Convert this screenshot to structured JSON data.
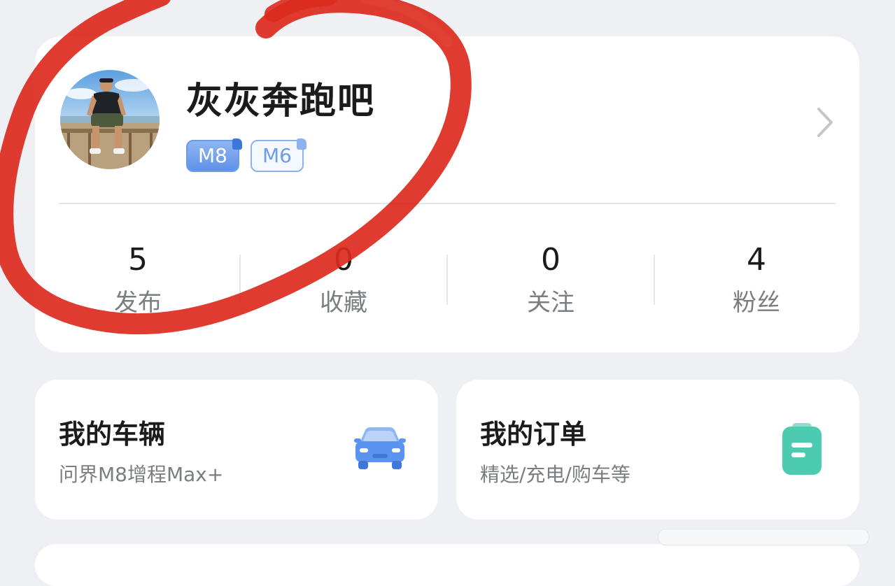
{
  "profile": {
    "username": "灰灰奔跑吧",
    "badges": [
      "M8",
      "M6"
    ],
    "avatar_icon": "user-avatar-photo",
    "chevron_icon": "chevron-right-icon"
  },
  "stats": [
    {
      "value": "5",
      "label": "发布"
    },
    {
      "value": "0",
      "label": "收藏"
    },
    {
      "value": "0",
      "label": "关注"
    },
    {
      "value": "4",
      "label": "粉丝"
    }
  ],
  "cards": {
    "vehicle": {
      "title": "我的车辆",
      "subtitle": "问界M8增程Max+",
      "icon": "car-icon",
      "icon_color": "#5b93f1"
    },
    "orders": {
      "title": "我的订单",
      "subtitle": "精选/充电/购车等",
      "icon": "order-list-icon",
      "icon_color": "#4ccbb0"
    }
  },
  "colors": {
    "background": "#eef0f3",
    "card": "#ffffff",
    "badge_blue": "#6d9be8",
    "annotation_red": "#dc2a1e"
  }
}
